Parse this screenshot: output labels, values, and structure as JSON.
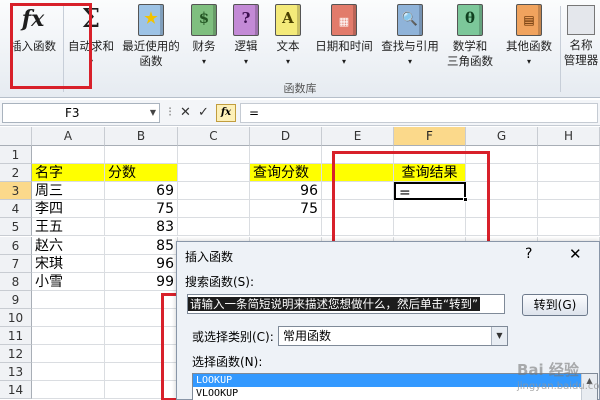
{
  "ribbon": {
    "buttons": {
      "insert_function": "插入函数",
      "autosum_line1": "自动求和",
      "recent_line1": "最近使用的",
      "recent_line2": "函数",
      "financial": "财务",
      "logical": "逻辑",
      "text": "文本",
      "datetime": "日期和时间",
      "lookup": "查找与引用",
      "math_line1": "数学和",
      "math_line2": "三角函数",
      "other": "其他函数",
      "name_mgr_line1": "名称",
      "name_mgr_line2": "管理器"
    },
    "group_label": "函数库",
    "icon_glyphs": {
      "insert_function": "fx",
      "autosum": "Σ",
      "recent": "★",
      "financial": "$",
      "logical": "?",
      "text": "A",
      "lookup": "🔍",
      "math": "θ"
    }
  },
  "formula_bar": {
    "name_box": "F3",
    "dropdown": "▼",
    "separator": "⁝",
    "cancel": "✕",
    "enter": "✓",
    "fx": "fx",
    "content": "="
  },
  "sheet": {
    "columns": [
      "A",
      "B",
      "C",
      "D",
      "E",
      "F",
      "G",
      "H"
    ],
    "rows": [
      "1",
      "2",
      "3",
      "4",
      "5",
      "6",
      "7",
      "8",
      "9",
      "10",
      "11",
      "12",
      "13",
      "14"
    ],
    "cells": {
      "A2": "名字",
      "B2": "分数",
      "A3": "周三",
      "B3": "69",
      "A4": "李四",
      "B4": "75",
      "A5": "王五",
      "B5": "83",
      "A6": "赵六",
      "B6": "85",
      "A7": "宋琪",
      "B7": "96",
      "A8": "小雪",
      "B8": "99",
      "D2": "查询分数",
      "D3": "96",
      "D4": "75",
      "F2": "查询结果",
      "F3": "="
    },
    "selected_cell": "F3"
  },
  "dialog": {
    "title": "插入函数",
    "help": "?",
    "close": "✕",
    "search_label": "搜索函数(S):",
    "search_value": "请输入一条简短说明来描述您想做什么，然后单击“转到”",
    "goto_button": "转到(G)",
    "category_label": "或选择类别(C):",
    "category_value": "常用函数",
    "category_dropdown": "▼",
    "select_label": "选择函数(N):",
    "functions": [
      "LOOKUP",
      "VLOOKUP"
    ],
    "scroll_up": "▲"
  },
  "watermark": {
    "logo": "Bai 经验",
    "url": "jingyan.baidu.com"
  },
  "colors": {
    "highlight_yellow": "#ffff00",
    "annotation_red": "#d8202a",
    "selected_header": "#fbd98b",
    "list_selection": "#3399ff"
  }
}
